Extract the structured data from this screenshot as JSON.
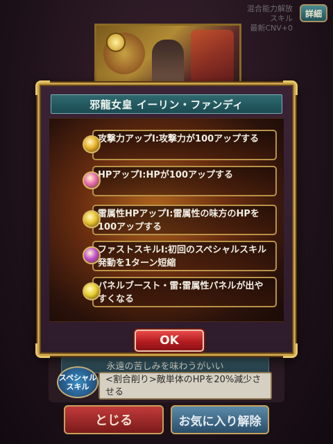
{
  "background": {
    "top_text_lines": [
      "混合能力解放",
      "スキル",
      "最新CNV+0"
    ],
    "detail_button": "詳細",
    "special_skill_name": "永遠の苦しみを味わうがいい",
    "special_badge": "スペシャルスキル",
    "special_desc": "<割合削り>敵単体のHPを20%減少させる",
    "close_button": "とじる",
    "favorite_button": "お気に入り解除"
  },
  "modal": {
    "title": "邪龍女皇 イーリン・ファンディ",
    "ok_button": "OK",
    "skills": [
      {
        "text": "攻撃力アップⅠ:攻撃力が100アップする",
        "icon": "attack-up-icon",
        "color": "#e8b428"
      },
      {
        "text": "HPアップⅠ:HPが100アップする",
        "icon": "hp-up-icon",
        "color": "#e86ab0"
      },
      {
        "text": "雷属性HPアップⅠ:雷属性の味方のHPを100アップする",
        "icon": "thunder-hp-up-icon",
        "color": "#e8c430"
      },
      {
        "text": "ファストスキルⅠ:初回のスペシャルスキル発動を1ターン短縮",
        "icon": "fast-skill-icon",
        "color": "#c050d0"
      },
      {
        "text": "パネルブースト・雷:雷属性パネルが出やすくなる",
        "icon": "panel-boost-icon",
        "color": "#e8d030"
      }
    ]
  },
  "colors": {
    "accent_gold": "#c9a14a",
    "title_teal": "#2f6a70",
    "ok_red": "#d0282c"
  }
}
